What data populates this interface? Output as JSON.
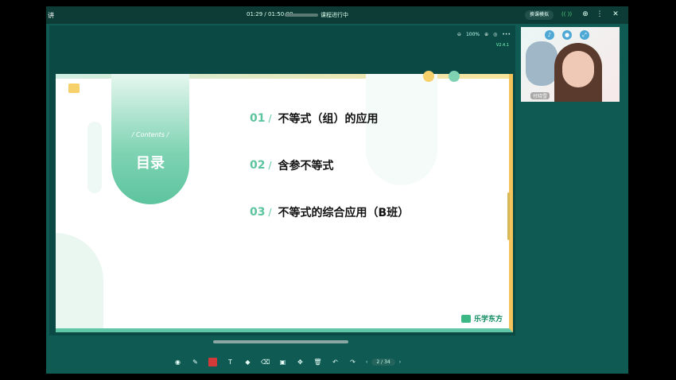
{
  "app": {
    "left_title": "讲",
    "time_current": "01:29",
    "time_sep": "/",
    "time_total": "01:50:00",
    "status": "课程进行中",
    "control_button": "换课模拟",
    "signal": "(( ))"
  },
  "toolbar_top": {
    "zoom": "100%",
    "version": "V2.4.1"
  },
  "slide": {
    "contents_label": "/ Contents /",
    "title": "目录",
    "items": [
      {
        "num": "01",
        "text": "不等式（组）的应用"
      },
      {
        "num": "02",
        "text": "含参不等式"
      },
      {
        "num": "03",
        "text": "不等式的综合应用（B班）"
      }
    ],
    "brand": "乐学东方"
  },
  "pager": {
    "current": "2",
    "sep": "/",
    "total": "34"
  },
  "video": {
    "name": "付晓雪"
  }
}
